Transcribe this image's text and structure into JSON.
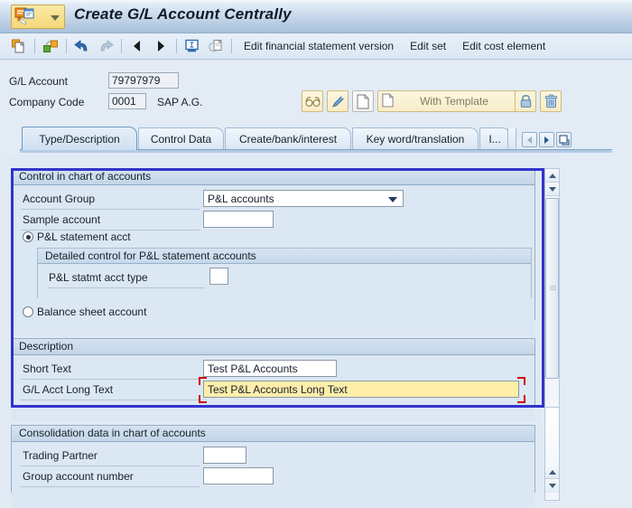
{
  "window": {
    "title": "Create G/L Account Centrally",
    "app_icon": "sap-session-icon",
    "menu_arrow_icon": "chevron-down-icon"
  },
  "toolbar": {
    "buttons": [
      {
        "name": "new-document-icon",
        "title": "Create"
      },
      {
        "name": "create-with-template-icon",
        "title": "Create with reference"
      },
      {
        "name": "undo-icon",
        "title": "Undo"
      },
      {
        "name": "redo-icon",
        "title": "Redo"
      },
      {
        "name": "previous-icon",
        "title": "Previous"
      },
      {
        "name": "next-icon",
        "title": "Next"
      },
      {
        "name": "display-change-icon",
        "title": "Display/Change"
      },
      {
        "name": "copy-page-icon",
        "title": "Copy"
      }
    ],
    "links": [
      "Edit financial statement version",
      "Edit set",
      "Edit cost element"
    ]
  },
  "header": {
    "gl_account_label": "G/L Account",
    "gl_account_value": "79797979",
    "company_code_label": "Company Code",
    "company_code_value": "0001",
    "company_name": "SAP A.G.",
    "actions": [
      {
        "name": "display-glasses-icon",
        "label": ""
      },
      {
        "name": "edit-pencil-icon",
        "label": ""
      },
      {
        "name": "new-page-icon",
        "label": ""
      }
    ],
    "with_template_label": "With Template",
    "lock_icon": "lock-icon",
    "delete_icon": "trash-icon"
  },
  "tabs": {
    "items": [
      {
        "label": "Type/Description",
        "active": true
      },
      {
        "label": "Control Data",
        "active": false
      },
      {
        "label": "Create/bank/interest",
        "active": false
      },
      {
        "label": "Key word/translation",
        "active": false
      },
      {
        "label": "I...",
        "active": false
      }
    ],
    "nav": [
      {
        "name": "tab-scroll-left-button",
        "icon": "caret-left-icon",
        "enabled": false
      },
      {
        "name": "tab-scroll-right-button",
        "icon": "caret-right-icon",
        "enabled": true
      },
      {
        "name": "tab-list-button",
        "icon": "tab-list-icon",
        "enabled": true
      }
    ]
  },
  "form": {
    "control_group": {
      "title": "Control in chart of accounts",
      "account_group_label": "Account Group",
      "account_group_value": "P&L accounts",
      "sample_account_label": "Sample account",
      "sample_account_value": "",
      "pl_radio_label": "P&L statement acct",
      "pl_radio_selected": true,
      "detail_title": "Detailed control for P&L statement accounts",
      "pl_type_label": "P&L statmt acct type",
      "pl_type_value": "",
      "balance_radio_label": "Balance sheet account",
      "balance_radio_selected": false
    },
    "description_group": {
      "title": "Description",
      "short_text_label": "Short Text",
      "short_text_value": "Test P&L Accounts",
      "long_text_label": "G/L Acct Long Text",
      "long_text_value": "Test P&L Accounts Long Text",
      "long_text_focused": true
    },
    "consolidation_group": {
      "title": "Consolidation data in chart of accounts",
      "trading_partner_label": "Trading Partner",
      "trading_partner_value": "",
      "group_account_label": "Group account number",
      "group_account_value": ""
    }
  },
  "scrollbars": {
    "outer": {
      "name": "outer-vertical-scrollbar",
      "up_icon": "caret-up-icon",
      "down_icon": "caret-down-icon"
    },
    "inner": {
      "name": "inner-vertical-scrollbar",
      "up_icon": "caret-up-icon",
      "down_icon": "caret-down-icon"
    }
  },
  "colors": {
    "focus_border": "#3333cc",
    "focused_field_bg": "#ffeeaa",
    "focus_marker": "#cc0000",
    "panel_bg": "#dbe7f2",
    "page_bg": "#e3ebf5"
  }
}
